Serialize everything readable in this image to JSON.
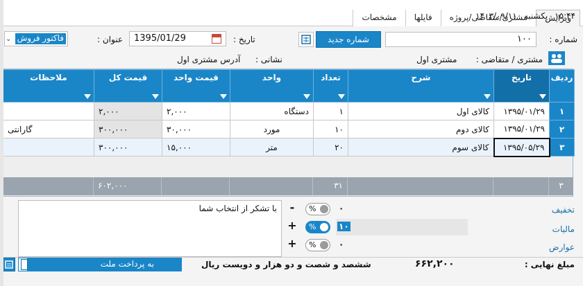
{
  "tabs": [
    "ویرایش",
    "مشتری/متقاضی/پروژه",
    "فایلها",
    "مشخصات"
  ],
  "clock": {
    "time": "۱۵:۴۴",
    "day": "یکشنبه",
    "date": "۱۴۰۳/۰۹/۱۱"
  },
  "form": {
    "number_label": "شماره :",
    "number_value": "۱۰۰",
    "new_number_button": "شماره جدید",
    "date_label": "تاریخ :",
    "date_value": "1395/01/29",
    "title_label": "عنوان :",
    "title_value": "فاکتور فروش",
    "customer_label": "مشتری / متقاضی :",
    "customer_value": "مشتری اول",
    "address_label": "نشانی :",
    "address_value": "آدرس مشتری اول"
  },
  "grid": {
    "columns": [
      "ردیف",
      "تاریخ",
      "شرح",
      "تعداد",
      "واحد",
      "قیمت واحد",
      "قیمت کل",
      "ملاحظات"
    ],
    "rows": [
      {
        "no": "۱",
        "date": "۱۳۹۵/۰۱/۲۹",
        "desc": "کالای اول",
        "qty": "۱",
        "unit": "دستگاه",
        "price": "۲,۰۰۰",
        "total": "۲,۰۰۰",
        "note": ""
      },
      {
        "no": "۲",
        "date": "۱۳۹۵/۰۱/۲۹",
        "desc": "کالای دوم",
        "qty": "۱۰",
        "unit": "مورد",
        "price": "۳۰,۰۰۰",
        "total": "۳۰۰,۰۰۰",
        "note": "گارانتی"
      },
      {
        "no": "۳",
        "date": "۱۳۹۵/۰۵/۲۹",
        "desc": "کالای سوم",
        "qty": "۲۰",
        "unit": "متر",
        "price": "۱۵,۰۰۰",
        "total": "۳۰۰,۰۰۰",
        "note": ""
      }
    ],
    "totals": {
      "count": "۳",
      "qty": "۳۱",
      "total": "۶۰۲,۰۰۰"
    }
  },
  "adjust": {
    "discount_label": "تخفیف",
    "tax_label": "مالیات",
    "duties_label": "عوارض",
    "discount_value": "۰",
    "tax_value": "۱۰",
    "duties_value": "۰",
    "percent_sign": "%",
    "minus": "-",
    "plus": "+"
  },
  "notes_text": "با تشکر از انتخاب شما",
  "footer": {
    "final_label": "مبلغ نهایی :",
    "final_value": "۶۶۲,۲۰۰",
    "final_words": "ششصد و شصت و دو هزار و دویست ریال",
    "payment_option": "به پرداخت ملت"
  },
  "colors": {
    "accent": "#1a86c8",
    "totals_bar": "#9aa4ae"
  }
}
